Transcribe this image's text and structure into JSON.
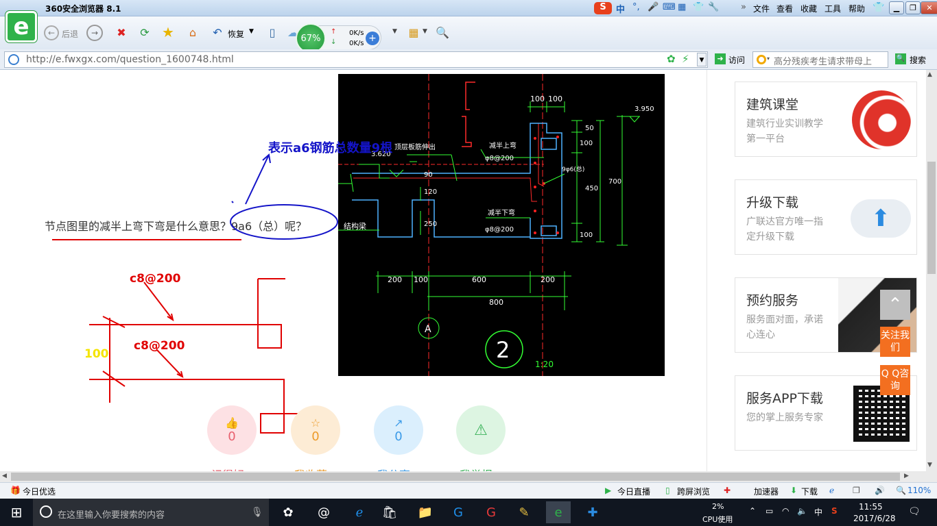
{
  "browser": {
    "title": "360安全浏览器 8.1",
    "logo_letter": "e",
    "ime": {
      "sogou": "S",
      "lang": "中"
    },
    "menu": [
      "文件",
      "查看",
      "收藏",
      "工具",
      "帮助"
    ],
    "toolbar": {
      "back": "后退",
      "restore": "恢复"
    },
    "speed": {
      "percent": "67%",
      "up": "0K/s",
      "down": "0K/s"
    },
    "url": "http://e.fwxgx.com/question_1600748.html",
    "visit_label": "访问",
    "search_placeholder": "高分残疾考生请求带母上",
    "search_button": "搜索"
  },
  "question": {
    "text": "节点图里的减半上弯下弯是什么意思？9a6（总）呢？",
    "annotation_blue": "表示a6钢筋总数量9根",
    "annotation_c8_top": "c8@200",
    "annotation_c8_bottom": "c8@200",
    "annotation_100": "100"
  },
  "cad": {
    "dims_top": [
      "100",
      "100"
    ],
    "elev_top": "3.950",
    "elev_left": "3.620",
    "label_left_top": "顶层板筋伸出",
    "label_jbs": "减半上弯",
    "label_jbs_spec": "φ8@200",
    "label_9a6": "9φ6(总)",
    "label_jbx": "减半下弯",
    "label_jbx_spec": "φ8@200",
    "label_beam": "结构梁",
    "vdims_left": [
      "90",
      "120",
      "250"
    ],
    "vdims_right": [
      "50",
      "100",
      "450",
      "100",
      "700"
    ],
    "hdims": [
      "200",
      "100",
      "600",
      "200"
    ],
    "total": "800",
    "axis": "A",
    "detail_no": "2",
    "scale": "1:20"
  },
  "actions": [
    {
      "count": "0",
      "label": "记得好"
    },
    {
      "count": "0",
      "label": "我收藏"
    },
    {
      "count": "0",
      "label": "我分享"
    },
    {
      "count": "0",
      "label": "我举报"
    }
  ],
  "sidebar": [
    {
      "title": "建筑课堂",
      "desc": "建筑行业实训教学第一平台"
    },
    {
      "title": "升级下载",
      "desc": "广联达官方唯一指定升级下载"
    },
    {
      "title": "预约服务",
      "desc": "服务面对面，承诺心连心"
    },
    {
      "title": "服务APP下载",
      "desc": "您的掌上服务专家"
    }
  ],
  "floating": {
    "follow": "关注我们",
    "qq": "Q Q咨询"
  },
  "statusbar": {
    "left": "今日优选",
    "items": [
      "今日直播",
      "跨屏浏览",
      "加速器",
      "下载"
    ],
    "zoom": "110%"
  },
  "taskbar": {
    "search_placeholder": "在这里输入你要搜索的内容",
    "cpu_percent": "2%",
    "cpu_label": "CPU使用",
    "ime": "中",
    "time": "11:55",
    "date": "2017/6/28"
  },
  "colors": {
    "accent": "#2fb24a",
    "orange": "#f36f20",
    "annotation_red": "#e00000",
    "annotation_blue": "#1414c8"
  }
}
